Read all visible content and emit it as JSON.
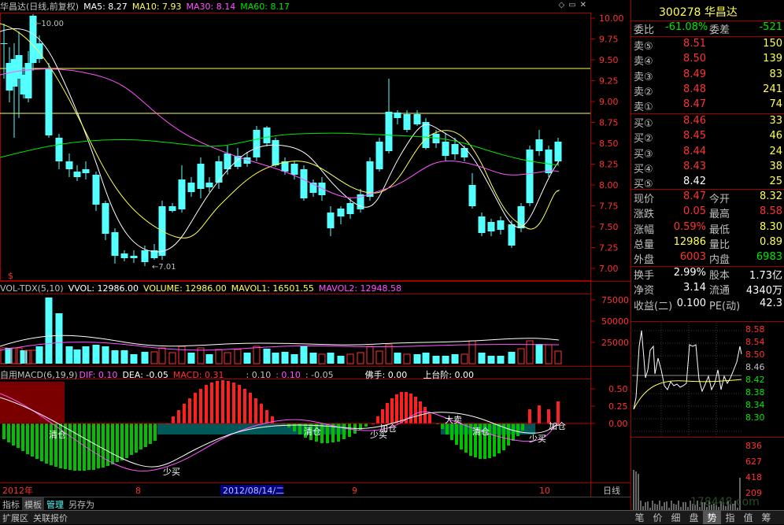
{
  "header": {
    "title": "华昌达(日线,前复权)",
    "ma5": "MA5: 8.27",
    "ma10": "MA10: 7.93",
    "ma30": "MA30: 8.14",
    "ma60": "MA60: 8.17"
  },
  "price_axis": [
    "10.00",
    "9.75",
    "9.50",
    "9.25",
    "9.00",
    "8.75",
    "8.50",
    "8.25",
    "8.00",
    "7.75",
    "7.50",
    "7.25",
    "7.00"
  ],
  "annotations": {
    "high": "10.00",
    "low": "7.01"
  },
  "vol_header": {
    "name": "VOL-TDX(5,10)",
    "vvol": "VVOL: 12986.00",
    "volume": "VOLUME: 12986.00",
    "mavol1": "MAVOL1: 16501.55",
    "mavol2": "MAVOL2: 12948.58"
  },
  "vol_axis": [
    "75000",
    "50000",
    "25000"
  ],
  "macd_header": {
    "name": "自用MACD(6,19,9)",
    "dif": "DIF: 0.10",
    "dea": "DEA: -0.05",
    "macd": "MACD: 0.31",
    "a": ": 0.10",
    "b": ": 0.10",
    "c": ": -0.05",
    "fs": "佛手: 0.00",
    "sts": "上台阶: 0.00"
  },
  "macd_axis": [
    "0.50",
    "0.25",
    "0.00"
  ],
  "macd_labels": [
    {
      "t": "清仓"
    },
    {
      "t": "少买"
    },
    {
      "t": "清仓"
    },
    {
      "t": "加仓"
    },
    {
      "t": "少买"
    },
    {
      "t": "大卖"
    },
    {
      "t": "清仓"
    },
    {
      "t": "加仓"
    },
    {
      "t": "少买"
    }
  ],
  "date_axis": {
    "year": "2012年",
    "m8": "8",
    "sel": "2012/08/14/二",
    "m9": "9",
    "m10": "10",
    "period": "日线"
  },
  "bottom_tabs": [
    "指标",
    "模板",
    "管理",
    "另存为"
  ],
  "status_tabs": [
    "扩展区",
    "关联报价"
  ],
  "right_tabs": [
    "笔",
    "价",
    "细",
    "盘",
    "势",
    "指",
    "值",
    "筹"
  ],
  "dollar_sign": "$",
  "quote": {
    "code_name": "300278 华昌达",
    "weibi_label": "委比",
    "weibi": "-61.08%",
    "weicha_label": "委差",
    "weicha": "-521",
    "sells": [
      {
        "l": "卖⑤",
        "p": "8.51",
        "v": "150"
      },
      {
        "l": "卖④",
        "p": "8.50",
        "v": "139"
      },
      {
        "l": "卖③",
        "p": "8.49",
        "v": "83"
      },
      {
        "l": "卖②",
        "p": "8.48",
        "v": "241"
      },
      {
        "l": "卖①",
        "p": "8.47",
        "v": "74"
      }
    ],
    "buys": [
      {
        "l": "买①",
        "p": "8.46",
        "v": "33"
      },
      {
        "l": "买②",
        "p": "8.45",
        "v": "46"
      },
      {
        "l": "买③",
        "p": "8.44",
        "v": "24"
      },
      {
        "l": "买④",
        "p": "8.43",
        "v": "38"
      },
      {
        "l": "买⑤",
        "p": "8.42",
        "v": "25"
      }
    ],
    "stats1": [
      {
        "l1": "现价",
        "v1": "8.47",
        "l2": "今开",
        "v2": "8.32"
      },
      {
        "l1": "涨跌",
        "v1": "0.05",
        "l2": "最高",
        "v2": "8.58"
      },
      {
        "l1": "涨幅",
        "v1": "0.59%",
        "l2": "最低",
        "v2": "8.30"
      },
      {
        "l1": "总量",
        "v1": "12986",
        "l2": "量比",
        "v2": "0.89"
      },
      {
        "l1": "外盘",
        "v1": "6003",
        "l2": "内盘",
        "v2": "6983"
      }
    ],
    "stats2": [
      {
        "l1": "换手",
        "v1": "2.99%",
        "l2": "股本",
        "v2": "1.73亿"
      },
      {
        "l1": "净资",
        "v1": "3.14",
        "l2": "流通",
        "v2": "4340万"
      },
      {
        "l1": "收益(二)",
        "v1": "0.100",
        "l2": "PE(动)",
        "v2": "42.3"
      }
    ],
    "mini_axis": [
      "8.58",
      "8.54",
      "8.50",
      "8.46",
      "8.42",
      "8.38",
      "8.34",
      "8.30"
    ],
    "mini_vol_axis": [
      "836",
      "627",
      "418",
      "209"
    ],
    "watermark": "178448.com"
  },
  "colors": {
    "up": "#ff3232",
    "down": "#54ffff",
    "ma5": "#ffffff",
    "ma10": "#ffff54",
    "ma30": "#ff54ff",
    "ma60": "#00e600",
    "axis": "#c00000"
  }
}
